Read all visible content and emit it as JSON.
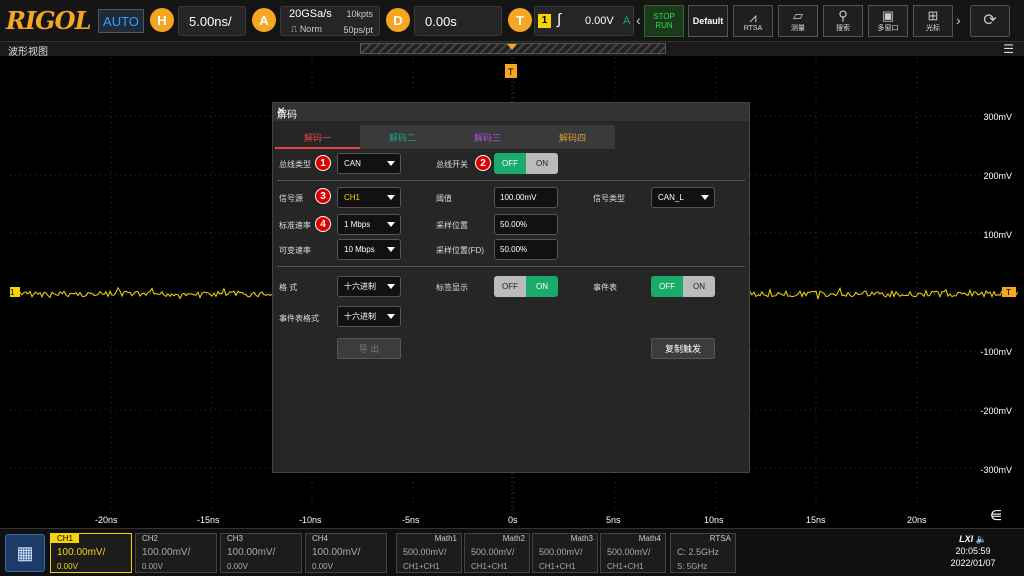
{
  "topbar": {
    "logo": "RIGOL",
    "auto": "AUTO",
    "h_label": "H",
    "h_value": "5.00ns/",
    "a_label": "A",
    "sample_rate": "20GSa/s",
    "mem_depth": "10kpts",
    "acq_mode": "Norm",
    "sample_period": "50ps/pt",
    "d_label": "D",
    "d_value": "0.00s",
    "t_label": "T",
    "trig_source": "1",
    "trig_level": "0.00V",
    "trig_mode": "A",
    "stop": "STOP",
    "run": "RUN",
    "default_label": "Default",
    "rtsa": "RTSA",
    "measure": "测量",
    "search": "搜索",
    "multiwindow": "多窗口",
    "cursor": "光标"
  },
  "wave_header": {
    "title": "波形视图"
  },
  "vertical_labels": [
    "300mV",
    "200mV",
    "100mV",
    "-100mV",
    "-200mV",
    "-300mV"
  ],
  "time_labels": [
    "-20ns",
    "-15ns",
    "-10ns",
    "-5ns",
    "0s",
    "5ns",
    "10ns",
    "15ns",
    "20ns"
  ],
  "dialog": {
    "title": "解码",
    "tabs": [
      {
        "label": "解码一",
        "color": "#e0464a"
      },
      {
        "label": "解码二",
        "color": "#1aa88a"
      },
      {
        "label": "解码三",
        "color": "#a655d6"
      },
      {
        "label": "解码四",
        "color": "#d89a3a"
      }
    ],
    "bus_type_label": "总线类型",
    "bus_type_value": "CAN",
    "bus_switch_label": "总线开关",
    "source_label": "信号源",
    "source_value": "CH1",
    "threshold_label": "阈值",
    "threshold_value": "100.00mV",
    "signal_type_label": "信号类型",
    "signal_type_value": "CAN_L",
    "baud_label": "标准速率",
    "baud_value": "1 Mbps",
    "sample_pos_label": "采样位置",
    "sample_pos_value": "50.00%",
    "var_rate_label": "可变速率",
    "var_rate_value": "10 Mbps",
    "sample_pos_fd_label": "采样位置(FD)",
    "sample_pos_fd_value": "50.00%",
    "format_label": "格  式",
    "format_value": "十六进制",
    "label_display_label": "标签显示",
    "event_table_label": "事件表",
    "event_format_label": "事件表格式",
    "event_format_value": "十六进制",
    "export_label": "导 出",
    "copy_trigger_label": "复制触发",
    "off": "OFF",
    "on": "ON",
    "badges": [
      "1",
      "2",
      "3",
      "4"
    ]
  },
  "bottombar": {
    "channels": [
      {
        "name": "CH1",
        "scale": "100.00mV/",
        "offset": "0.00V"
      },
      {
        "name": "CH2",
        "scale": "100.00mV/",
        "offset": "0.00V"
      },
      {
        "name": "CH3",
        "scale": "100.00mV/",
        "offset": "0.00V"
      },
      {
        "name": "CH4",
        "scale": "100.00mV/",
        "offset": "0.00V"
      }
    ],
    "maths": [
      {
        "name": "Math1",
        "scale": "500.00mV/",
        "expr": "CH1+CH1"
      },
      {
        "name": "Math2",
        "scale": "500.00mV/",
        "expr": "CH1+CH1"
      },
      {
        "name": "Math3",
        "scale": "500.00mV/",
        "expr": "CH1+CH1"
      },
      {
        "name": "Math4",
        "scale": "500.00mV/",
        "expr": "CH1+CH1"
      }
    ],
    "rtsa": {
      "name": "RTSA",
      "center": "C: 2.5GHz",
      "span": "S: 5GHz"
    },
    "lxi": "LXI",
    "time": "20:05:59",
    "date": "2022/01/07"
  },
  "colors": {
    "ch1": "#f5d50a",
    "accent": "#f5a623",
    "on": "#1aaa6a"
  }
}
